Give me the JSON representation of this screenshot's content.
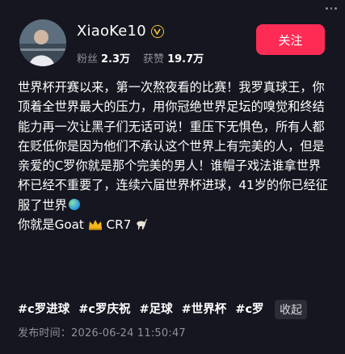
{
  "author": {
    "username": "XiaoKe10",
    "verified_icon": "verified-badge-icon",
    "avatar_icon": "avatar",
    "stats": {
      "followers_label": "粉丝",
      "followers_value": "2.3万",
      "likes_label": "获赞",
      "likes_value": "19.7万"
    }
  },
  "actions": {
    "follow_label": "关注",
    "more_icon": "more-options-icon",
    "collapse_label": "收起"
  },
  "post": {
    "text_main": "世界杯开赛以来，第一次熬夜看的比赛！我罗真球王，你顶着全世界最大的压力，用你冠绝世界足坛的嗅觉和终结能力再一次让黑子们无话可说！重压下无惧色，所有人都在贬低你是因为他们不承认这个世界上有完美的人，但是亲爱的C罗你就是那个完美的男人！谁帽子戏法谁拿世界杯已经不重要了，连续六届世界杯进球，41岁的你已经征服了世界",
    "line2_a": "你就是Goat",
    "line2_b": " CR7",
    "hashtags": [
      "#c罗进球",
      "#c罗庆祝",
      "#足球",
      "#世界杯",
      "#c罗"
    ],
    "publish_label": "发布时间：",
    "publish_time": "2026-06-24 11:50:47"
  },
  "colors": {
    "background": "#15161f",
    "accent": "#fe2c55",
    "muted": "#8f909a",
    "verified": "#f1c23a"
  }
}
